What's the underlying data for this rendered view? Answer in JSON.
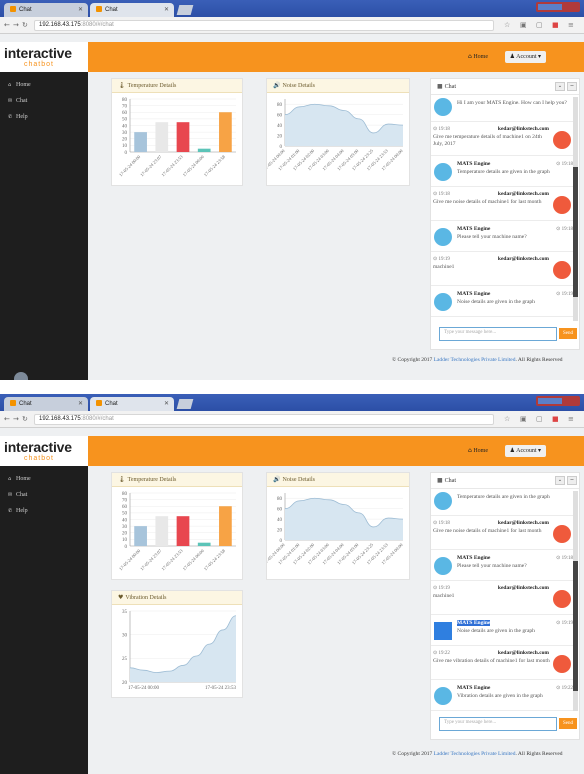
{
  "browser": {
    "tab_inactive": "Chat",
    "tab_active": "Chat",
    "url_host": "192.168.43.175",
    "url_path": ":8080/#/chat"
  },
  "app": {
    "logo_main": "interactive",
    "logo_sub": "chatbot",
    "nav_home": "Home",
    "nav_account": "Account",
    "sidebar": [
      "Home",
      "Chat",
      "Help"
    ]
  },
  "panels": {
    "temperature": "Temperature Details",
    "noise": "Noise Details",
    "vibration": "Vibration Details",
    "chat": "Chat"
  },
  "chat": {
    "input_placeholder": "Type your message here...",
    "send_label": "Send",
    "user_name": "kedar@linkstech.com",
    "bot_name": "MATS Engine",
    "time": "19:18",
    "time2": "19:22",
    "shot1": [
      {
        "who": "bot",
        "name": "",
        "time": "",
        "text": "Hi I am your MATS Engine. How can I help you?"
      },
      {
        "who": "user",
        "name": "kedar@linkstech.com",
        "time": "19:18",
        "text": "Give me temperature details of machine1 on 24th July, 2017"
      },
      {
        "who": "bot",
        "name": "MATS Engine",
        "time": "19:18",
        "text": "Temperature details are given in the graph"
      },
      {
        "who": "user",
        "name": "kedar@linkstech.com",
        "time": "19:18",
        "text": "Give me noise details of machine1 for last month"
      },
      {
        "who": "bot",
        "name": "MATS Engine",
        "time": "19:18",
        "text": "Please tell your machine name?"
      },
      {
        "who": "user",
        "name": "kedar@linkstech.com",
        "time": "19:19",
        "text": "machine1"
      },
      {
        "who": "bot",
        "name": "MATS Engine",
        "time": "19:19",
        "text": "Noise details are given in the graph"
      }
    ],
    "shot2": [
      {
        "who": "bot",
        "name": "",
        "time": "",
        "text": "Temperature details are given in the graph"
      },
      {
        "who": "user",
        "name": "kedar@linkstech.com",
        "time": "19:18",
        "text": "Give me noise details of machine1 for last month"
      },
      {
        "who": "bot",
        "name": "MATS Engine",
        "time": "19:18",
        "text": "Please tell your machine name?"
      },
      {
        "who": "user",
        "name": "kedar@linkstech.com",
        "time": "19:19",
        "text": "machine1"
      },
      {
        "who": "bot",
        "name": "MATS Engine",
        "time": "19:19",
        "text": "Noise details are given in the graph",
        "selected": true
      },
      {
        "who": "user",
        "name": "kedar@linkstech.com",
        "time": "19:22",
        "text": "Give me vibration details of machine1 for last month"
      },
      {
        "who": "bot",
        "name": "MATS Engine",
        "time": "19:22",
        "text": "Vibration details are given in the graph"
      }
    ]
  },
  "footer": {
    "prefix": "© Copyright 2017",
    "company": "Ladder Technologies Private Limited",
    "suffix": ". All Rights Reserved"
  },
  "chart_data": [
    {
      "type": "bar",
      "title": "Temperature Details",
      "categories": [
        "17-05-24 00:00",
        "17-05-24 23:07",
        "17-05-24 23:53",
        "17-05-24 00:00",
        "17-05-24 23:58"
      ],
      "values": [
        30,
        45,
        45,
        5,
        60
      ],
      "colors": [
        "#a7c4db",
        "#e8e8e8",
        "#e8474f",
        "#5cc4b8",
        "#f7a345"
      ],
      "yticks": [
        0,
        10,
        20,
        30,
        40,
        50,
        60,
        70,
        80
      ],
      "ylim": [
        0,
        80
      ]
    },
    {
      "type": "area",
      "title": "Noise Details",
      "x": [
        "17-05-24 00:00",
        "17-05-24 01:00",
        "17-05-24 02:00",
        "17-05-24 03:00",
        "17-05-24 04:00",
        "17-05-24 05:00",
        "17-05-24 23:25",
        "17-05-24 23:53",
        "17-05-24 00:00"
      ],
      "values": [
        60,
        75,
        80,
        77,
        68,
        52,
        25,
        42,
        40
      ],
      "yticks": [
        0,
        20,
        40,
        60,
        80
      ],
      "ylim": [
        0,
        90
      ]
    },
    {
      "type": "area",
      "title": "Vibration Details",
      "x": [
        "17-05-24 00:00",
        "17-05-24 23:53"
      ],
      "values": [
        23,
        22.5,
        22,
        22.3,
        23.5,
        25.5,
        28,
        31,
        34
      ],
      "yticks": [
        20,
        25,
        30,
        35
      ],
      "ylim": [
        20,
        35
      ]
    }
  ]
}
